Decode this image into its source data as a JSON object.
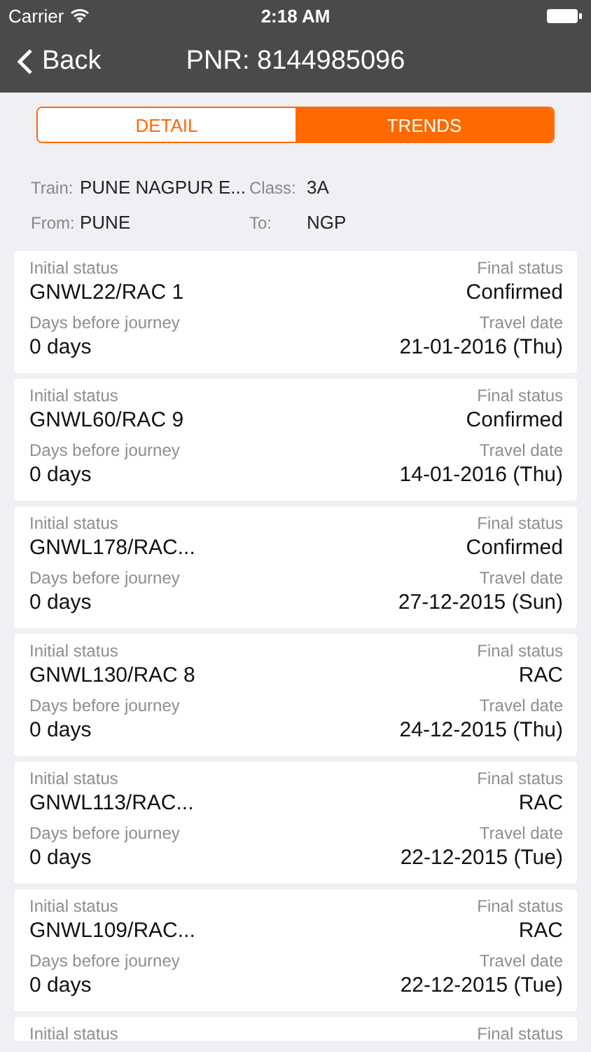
{
  "status_bar": {
    "carrier": "Carrier",
    "time": "2:18 AM"
  },
  "nav": {
    "back": "Back",
    "title": "PNR: 8144985096"
  },
  "tabs": [
    {
      "label": "DETAIL",
      "selected": false
    },
    {
      "label": "TRENDS",
      "selected": true
    }
  ],
  "info": {
    "train_label": "Train:",
    "train": "PUNE NAGPUR E...",
    "class_label": "Class:",
    "class": "3A",
    "from_label": "From:",
    "from": "PUNE",
    "to_label": "To:",
    "to": "NGP"
  },
  "records": [
    {
      "initial_label": "Initial status",
      "initial": "GNWL22/RAC 1",
      "days_label": "Days before journey",
      "days": "0 days",
      "final_label": "Final status",
      "final": "Confirmed",
      "date_label": "Travel date",
      "date": "21-01-2016 (Thu)"
    },
    {
      "initial_label": "Initial status",
      "initial": "GNWL60/RAC 9",
      "days_label": "Days before journey",
      "days": "0 days",
      "final_label": "Final status",
      "final": "Confirmed",
      "date_label": "Travel date",
      "date": "14-01-2016 (Thu)"
    },
    {
      "initial_label": "Initial status",
      "initial": "GNWL178/RAC...",
      "days_label": "Days before journey",
      "days": "0 days",
      "final_label": "Final status",
      "final": "Confirmed",
      "date_label": "Travel date",
      "date": "27-12-2015 (Sun)"
    },
    {
      "initial_label": "Initial status",
      "initial": "GNWL130/RAC 8",
      "days_label": "Days before journey",
      "days": "0 days",
      "final_label": "Final status",
      "final": "RAC",
      "date_label": "Travel date",
      "date": "24-12-2015 (Thu)"
    },
    {
      "initial_label": "Initial status",
      "initial": "GNWL113/RAC...",
      "days_label": "Days before journey",
      "days": "0 days",
      "final_label": "Final status",
      "final": "RAC",
      "date_label": "Travel date",
      "date": "22-12-2015 (Tue)"
    },
    {
      "initial_label": "Initial status",
      "initial": "GNWL109/RAC...",
      "days_label": "Days before journey",
      "days": "0 days",
      "final_label": "Final status",
      "final": "RAC",
      "date_label": "Travel date",
      "date": "22-12-2015 (Tue)"
    },
    {
      "initial_label": "Initial status",
      "final_label": "Final status"
    }
  ]
}
